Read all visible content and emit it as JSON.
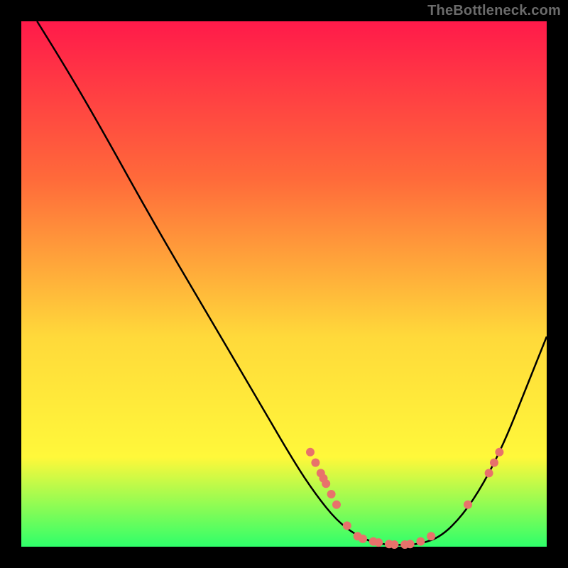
{
  "watermark": "TheBottleneck.com",
  "chart_data": {
    "type": "line",
    "title": "",
    "xlabel": "",
    "ylabel": "",
    "xlim": [
      0,
      100
    ],
    "ylim": [
      0,
      100
    ],
    "background_gradient": {
      "top": "#ff1a4a",
      "mid1": "#ff6a3a",
      "mid2": "#ffd93a",
      "mid3": "#fff83a",
      "bottom": "#2fff6a"
    },
    "curve": [
      {
        "x": 3,
        "y": 100
      },
      {
        "x": 8,
        "y": 92
      },
      {
        "x": 15,
        "y": 80
      },
      {
        "x": 25,
        "y": 62
      },
      {
        "x": 35,
        "y": 45
      },
      {
        "x": 45,
        "y": 28
      },
      {
        "x": 52,
        "y": 16
      },
      {
        "x": 56,
        "y": 10
      },
      {
        "x": 60,
        "y": 5
      },
      {
        "x": 64,
        "y": 2
      },
      {
        "x": 68,
        "y": 0.5
      },
      {
        "x": 72,
        "y": 0.3
      },
      {
        "x": 76,
        "y": 0.5
      },
      {
        "x": 80,
        "y": 2
      },
      {
        "x": 84,
        "y": 6
      },
      {
        "x": 88,
        "y": 12
      },
      {
        "x": 92,
        "y": 20
      },
      {
        "x": 96,
        "y": 30
      },
      {
        "x": 100,
        "y": 40
      }
    ],
    "markers": [
      {
        "x": 55,
        "y": 18
      },
      {
        "x": 56,
        "y": 16
      },
      {
        "x": 57,
        "y": 14
      },
      {
        "x": 57.5,
        "y": 13
      },
      {
        "x": 58,
        "y": 12
      },
      {
        "x": 59,
        "y": 10
      },
      {
        "x": 60,
        "y": 8
      },
      {
        "x": 62,
        "y": 4
      },
      {
        "x": 64,
        "y": 2
      },
      {
        "x": 65,
        "y": 1.5
      },
      {
        "x": 67,
        "y": 1
      },
      {
        "x": 68,
        "y": 0.8
      },
      {
        "x": 70,
        "y": 0.5
      },
      {
        "x": 71,
        "y": 0.4
      },
      {
        "x": 73,
        "y": 0.4
      },
      {
        "x": 74,
        "y": 0.5
      },
      {
        "x": 76,
        "y": 1
      },
      {
        "x": 78,
        "y": 2
      },
      {
        "x": 85,
        "y": 8
      },
      {
        "x": 89,
        "y": 14
      },
      {
        "x": 90,
        "y": 16
      },
      {
        "x": 91,
        "y": 18
      }
    ],
    "marker_color": "#e8726b",
    "curve_color": "#000000"
  }
}
